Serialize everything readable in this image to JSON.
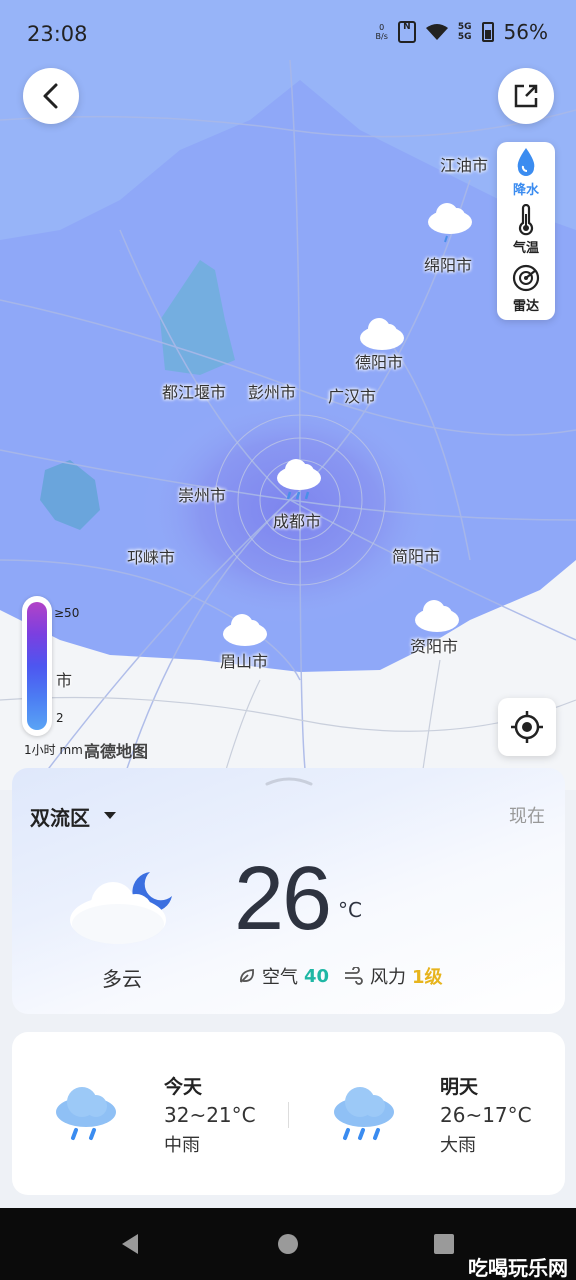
{
  "status_bar": {
    "time": "23:08",
    "net_speed_value": "0",
    "net_speed_unit": "B/s",
    "signal_label_1": "5G",
    "signal_label_2": "5G",
    "battery": "56%"
  },
  "layers": [
    {
      "label": "降水",
      "icon": "raindrop-icon",
      "active": true
    },
    {
      "label": "气温",
      "icon": "thermometer-icon",
      "active": false
    },
    {
      "label": "雷达",
      "icon": "radar-icon",
      "active": false
    }
  ],
  "cities": {
    "jiangyou": "江油市",
    "mianyang": "绵阳市",
    "deyang": "德阳市",
    "dujiangyan": "都江堰市",
    "pengzhou": "彭州市",
    "guanghan": "广汉市",
    "chongzhou": "崇州市",
    "chengdu": "成都市",
    "qionglai": "邛崃市",
    "jianyang": "简阳市",
    "meishan": "眉山市",
    "ziyang": "资阳市",
    "partial_left": "市"
  },
  "legend": {
    "max": "≥50",
    "min": "2",
    "unit": "1小时 mm",
    "provider": "高德地图"
  },
  "now": {
    "district": "双流区",
    "label": "现在",
    "temperature": "26",
    "unit": "°C",
    "condition": "多云",
    "air_label": "空气",
    "air_value": "40",
    "wind_label": "风力",
    "wind_value": "1级",
    "icon": "partly-cloudy-night-icon"
  },
  "forecast": [
    {
      "day": "今天",
      "temp": "32~21°C",
      "cond": "中雨",
      "icon": "moderate-rain-icon"
    },
    {
      "day": "明天",
      "temp": "26~17°C",
      "cond": "大雨",
      "icon": "heavy-rain-icon"
    }
  ],
  "colors": {
    "accent": "#3b8cf0",
    "air_good": "#1fb7a5",
    "wind": "#e7b41d",
    "precip_area": "#8fa8f8"
  },
  "watermark": "吃喝玩乐网"
}
